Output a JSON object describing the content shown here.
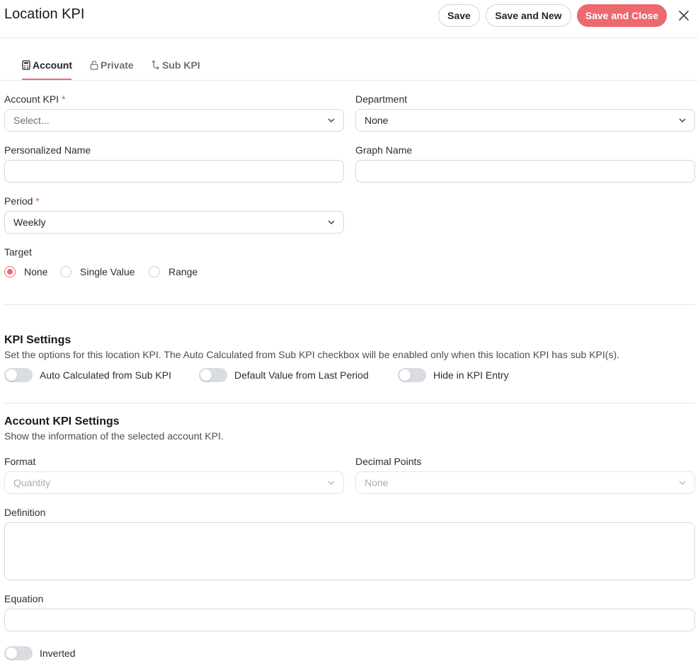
{
  "header": {
    "title": "Location KPI",
    "save_label": "Save",
    "save_new_label": "Save and New",
    "save_close_label": "Save and Close",
    "close_icon": "close-icon",
    "accent_color": "#ec6a6e"
  },
  "tabs": [
    {
      "label": "Account",
      "icon": "calculator-icon",
      "active": true
    },
    {
      "label": "Private",
      "icon": "lock-icon",
      "active": false
    },
    {
      "label": "Sub KPI",
      "icon": "subitem-icon",
      "active": false
    }
  ],
  "form": {
    "account_kpi": {
      "label": "Account KPI",
      "required": "*",
      "placeholder": "Select..."
    },
    "department": {
      "label": "Department",
      "value": "None"
    },
    "personalized_name": {
      "label": "Personalized Name",
      "value": ""
    },
    "graph_name": {
      "label": "Graph Name",
      "value": ""
    },
    "period": {
      "label": "Period",
      "required": "*",
      "value": "Weekly"
    },
    "target": {
      "label": "Target",
      "options": [
        "None",
        "Single Value",
        "Range"
      ],
      "selected": "None"
    }
  },
  "kpi_settings": {
    "title": "KPI Settings",
    "description": "Set the options for this location KPI. The Auto Calculated from Sub KPI checkbox will be enabled only when this location KPI has sub KPI(s).",
    "toggles": [
      {
        "label": "Auto Calculated from Sub KPI",
        "on": false
      },
      {
        "label": "Default Value from Last Period",
        "on": false
      },
      {
        "label": "Hide in KPI Entry",
        "on": false
      }
    ]
  },
  "account_kpi_settings": {
    "title": "Account KPI Settings",
    "description": "Show the information of the selected account KPI.",
    "format": {
      "label": "Format",
      "value": "Quantity"
    },
    "decimal_points": {
      "label": "Decimal Points",
      "value": "None"
    },
    "definition": {
      "label": "Definition",
      "value": ""
    },
    "equation": {
      "label": "Equation",
      "value": ""
    },
    "inverted": {
      "label": "Inverted",
      "on": false
    }
  }
}
